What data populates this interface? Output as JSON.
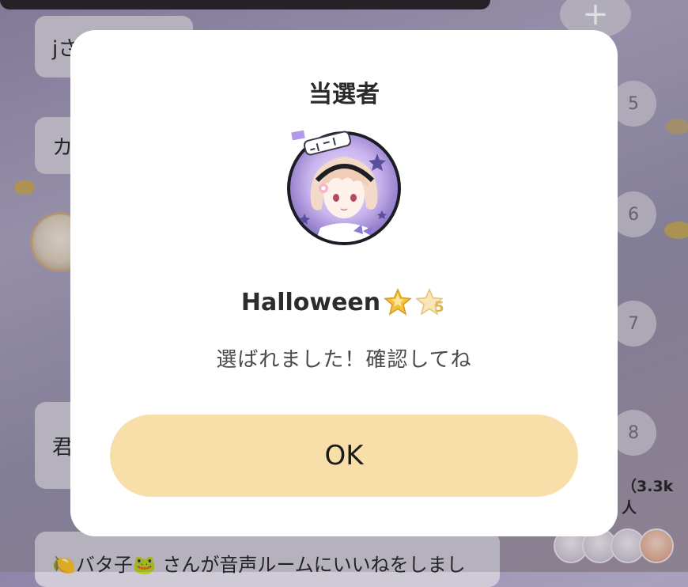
{
  "background": {
    "messages": [
      {
        "text": "jさ"
      },
      {
        "text": "カ"
      },
      {
        "text": "君"
      },
      {
        "text": "🍋バタ子🐸 さんが音声ルームにいいねをしまし"
      }
    ],
    "seat_numbers": [
      "5",
      "6",
      "7",
      "8"
    ],
    "add_icon": "+",
    "listener_count": "（3.3k人"
  },
  "dialog": {
    "title": "当選者",
    "winner_name": "Halloween",
    "badge_level": "5",
    "message": "選ばれました！確認してね",
    "ok_label": "OK"
  },
  "colors": {
    "ok_button": "#f8dfa9",
    "modal_bg": "#ffffff",
    "badge_gold": "#f2c23c",
    "avatar_ring": "#1c1c24"
  }
}
